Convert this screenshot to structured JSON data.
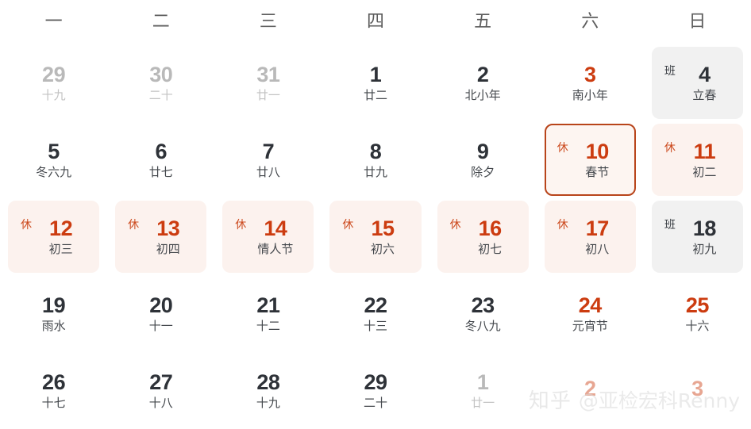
{
  "calendar": {
    "weekday_headers": [
      "一",
      "二",
      "三",
      "四",
      "五",
      "六",
      "日"
    ],
    "weeks": [
      [
        {
          "day": "29",
          "sub": "十九",
          "tone": "muted",
          "sub_tone": "muted",
          "badge": "",
          "bg": "none",
          "today": false
        },
        {
          "day": "30",
          "sub": "二十",
          "tone": "muted",
          "sub_tone": "muted",
          "badge": "",
          "bg": "none",
          "today": false
        },
        {
          "day": "31",
          "sub": "廿一",
          "tone": "muted",
          "sub_tone": "muted",
          "badge": "",
          "bg": "none",
          "today": false
        },
        {
          "day": "1",
          "sub": "廿二",
          "tone": "dark",
          "sub_tone": "norm",
          "badge": "",
          "bg": "none",
          "today": false
        },
        {
          "day": "2",
          "sub": "北小年",
          "tone": "dark",
          "sub_tone": "norm",
          "badge": "",
          "bg": "none",
          "today": false
        },
        {
          "day": "3",
          "sub": "南小年",
          "tone": "weekend",
          "sub_tone": "norm",
          "badge": "",
          "bg": "none",
          "today": false
        },
        {
          "day": "4",
          "sub": "立春",
          "tone": "dark",
          "sub_tone": "norm",
          "badge": "班",
          "bg": "work",
          "today": false
        }
      ],
      [
        {
          "day": "5",
          "sub": "冬六九",
          "tone": "dark",
          "sub_tone": "norm",
          "badge": "",
          "bg": "none",
          "today": false
        },
        {
          "day": "6",
          "sub": "廿七",
          "tone": "dark",
          "sub_tone": "norm",
          "badge": "",
          "bg": "none",
          "today": false
        },
        {
          "day": "7",
          "sub": "廿八",
          "tone": "dark",
          "sub_tone": "norm",
          "badge": "",
          "bg": "none",
          "today": false
        },
        {
          "day": "8",
          "sub": "廿九",
          "tone": "dark",
          "sub_tone": "norm",
          "badge": "",
          "bg": "none",
          "today": false
        },
        {
          "day": "9",
          "sub": "除夕",
          "tone": "dark",
          "sub_tone": "norm",
          "badge": "",
          "bg": "none",
          "today": false
        },
        {
          "day": "10",
          "sub": "春节",
          "tone": "weekend",
          "sub_tone": "norm",
          "badge": "休",
          "bg": "holiday",
          "today": true
        },
        {
          "day": "11",
          "sub": "初二",
          "tone": "weekend",
          "sub_tone": "norm",
          "badge": "休",
          "bg": "holiday",
          "today": false
        }
      ],
      [
        {
          "day": "12",
          "sub": "初三",
          "tone": "weekend",
          "sub_tone": "norm",
          "badge": "休",
          "bg": "holiday",
          "today": false
        },
        {
          "day": "13",
          "sub": "初四",
          "tone": "weekend",
          "sub_tone": "norm",
          "badge": "休",
          "bg": "holiday",
          "today": false
        },
        {
          "day": "14",
          "sub": "情人节",
          "tone": "weekend",
          "sub_tone": "norm",
          "badge": "休",
          "bg": "holiday",
          "today": false
        },
        {
          "day": "15",
          "sub": "初六",
          "tone": "weekend",
          "sub_tone": "norm",
          "badge": "休",
          "bg": "holiday",
          "today": false
        },
        {
          "day": "16",
          "sub": "初七",
          "tone": "weekend",
          "sub_tone": "norm",
          "badge": "休",
          "bg": "holiday",
          "today": false
        },
        {
          "day": "17",
          "sub": "初八",
          "tone": "weekend",
          "sub_tone": "norm",
          "badge": "休",
          "bg": "holiday",
          "today": false
        },
        {
          "day": "18",
          "sub": "初九",
          "tone": "dark",
          "sub_tone": "norm",
          "badge": "班",
          "bg": "work",
          "today": false
        }
      ],
      [
        {
          "day": "19",
          "sub": "雨水",
          "tone": "dark",
          "sub_tone": "norm",
          "badge": "",
          "bg": "none",
          "today": false
        },
        {
          "day": "20",
          "sub": "十一",
          "tone": "dark",
          "sub_tone": "norm",
          "badge": "",
          "bg": "none",
          "today": false
        },
        {
          "day": "21",
          "sub": "十二",
          "tone": "dark",
          "sub_tone": "norm",
          "badge": "",
          "bg": "none",
          "today": false
        },
        {
          "day": "22",
          "sub": "十三",
          "tone": "dark",
          "sub_tone": "norm",
          "badge": "",
          "bg": "none",
          "today": false
        },
        {
          "day": "23",
          "sub": "冬八九",
          "tone": "dark",
          "sub_tone": "norm",
          "badge": "",
          "bg": "none",
          "today": false
        },
        {
          "day": "24",
          "sub": "元宵节",
          "tone": "weekend",
          "sub_tone": "norm",
          "badge": "",
          "bg": "none",
          "today": false
        },
        {
          "day": "25",
          "sub": "十六",
          "tone": "weekend",
          "sub_tone": "norm",
          "badge": "",
          "bg": "none",
          "today": false
        }
      ],
      [
        {
          "day": "26",
          "sub": "十七",
          "tone": "dark",
          "sub_tone": "norm",
          "badge": "",
          "bg": "none",
          "today": false
        },
        {
          "day": "27",
          "sub": "十八",
          "tone": "dark",
          "sub_tone": "norm",
          "badge": "",
          "bg": "none",
          "today": false
        },
        {
          "day": "28",
          "sub": "十九",
          "tone": "dark",
          "sub_tone": "norm",
          "badge": "",
          "bg": "none",
          "today": false
        },
        {
          "day": "29",
          "sub": "二十",
          "tone": "dark",
          "sub_tone": "norm",
          "badge": "",
          "bg": "none",
          "today": false
        },
        {
          "day": "1",
          "sub": "廿一",
          "tone": "muted",
          "sub_tone": "muted",
          "badge": "",
          "bg": "none",
          "today": false
        },
        {
          "day": "2",
          "sub": "",
          "tone": "weekend-muted",
          "sub_tone": "muted",
          "badge": "",
          "bg": "none",
          "today": false
        },
        {
          "day": "3",
          "sub": "",
          "tone": "weekend-muted",
          "sub_tone": "muted",
          "badge": "",
          "bg": "none",
          "today": false
        }
      ]
    ]
  },
  "watermark": {
    "logo_text": "知乎",
    "user_text": "@亚检宏科Renny"
  },
  "colors": {
    "weekend_red": "#cc3c10",
    "holiday_bg": "#fcf2ee",
    "workday_bg": "#f1f1f1",
    "today_border": "#b8441a",
    "muted_text": "#b9b9b9",
    "dark_text": "#2e3238"
  }
}
